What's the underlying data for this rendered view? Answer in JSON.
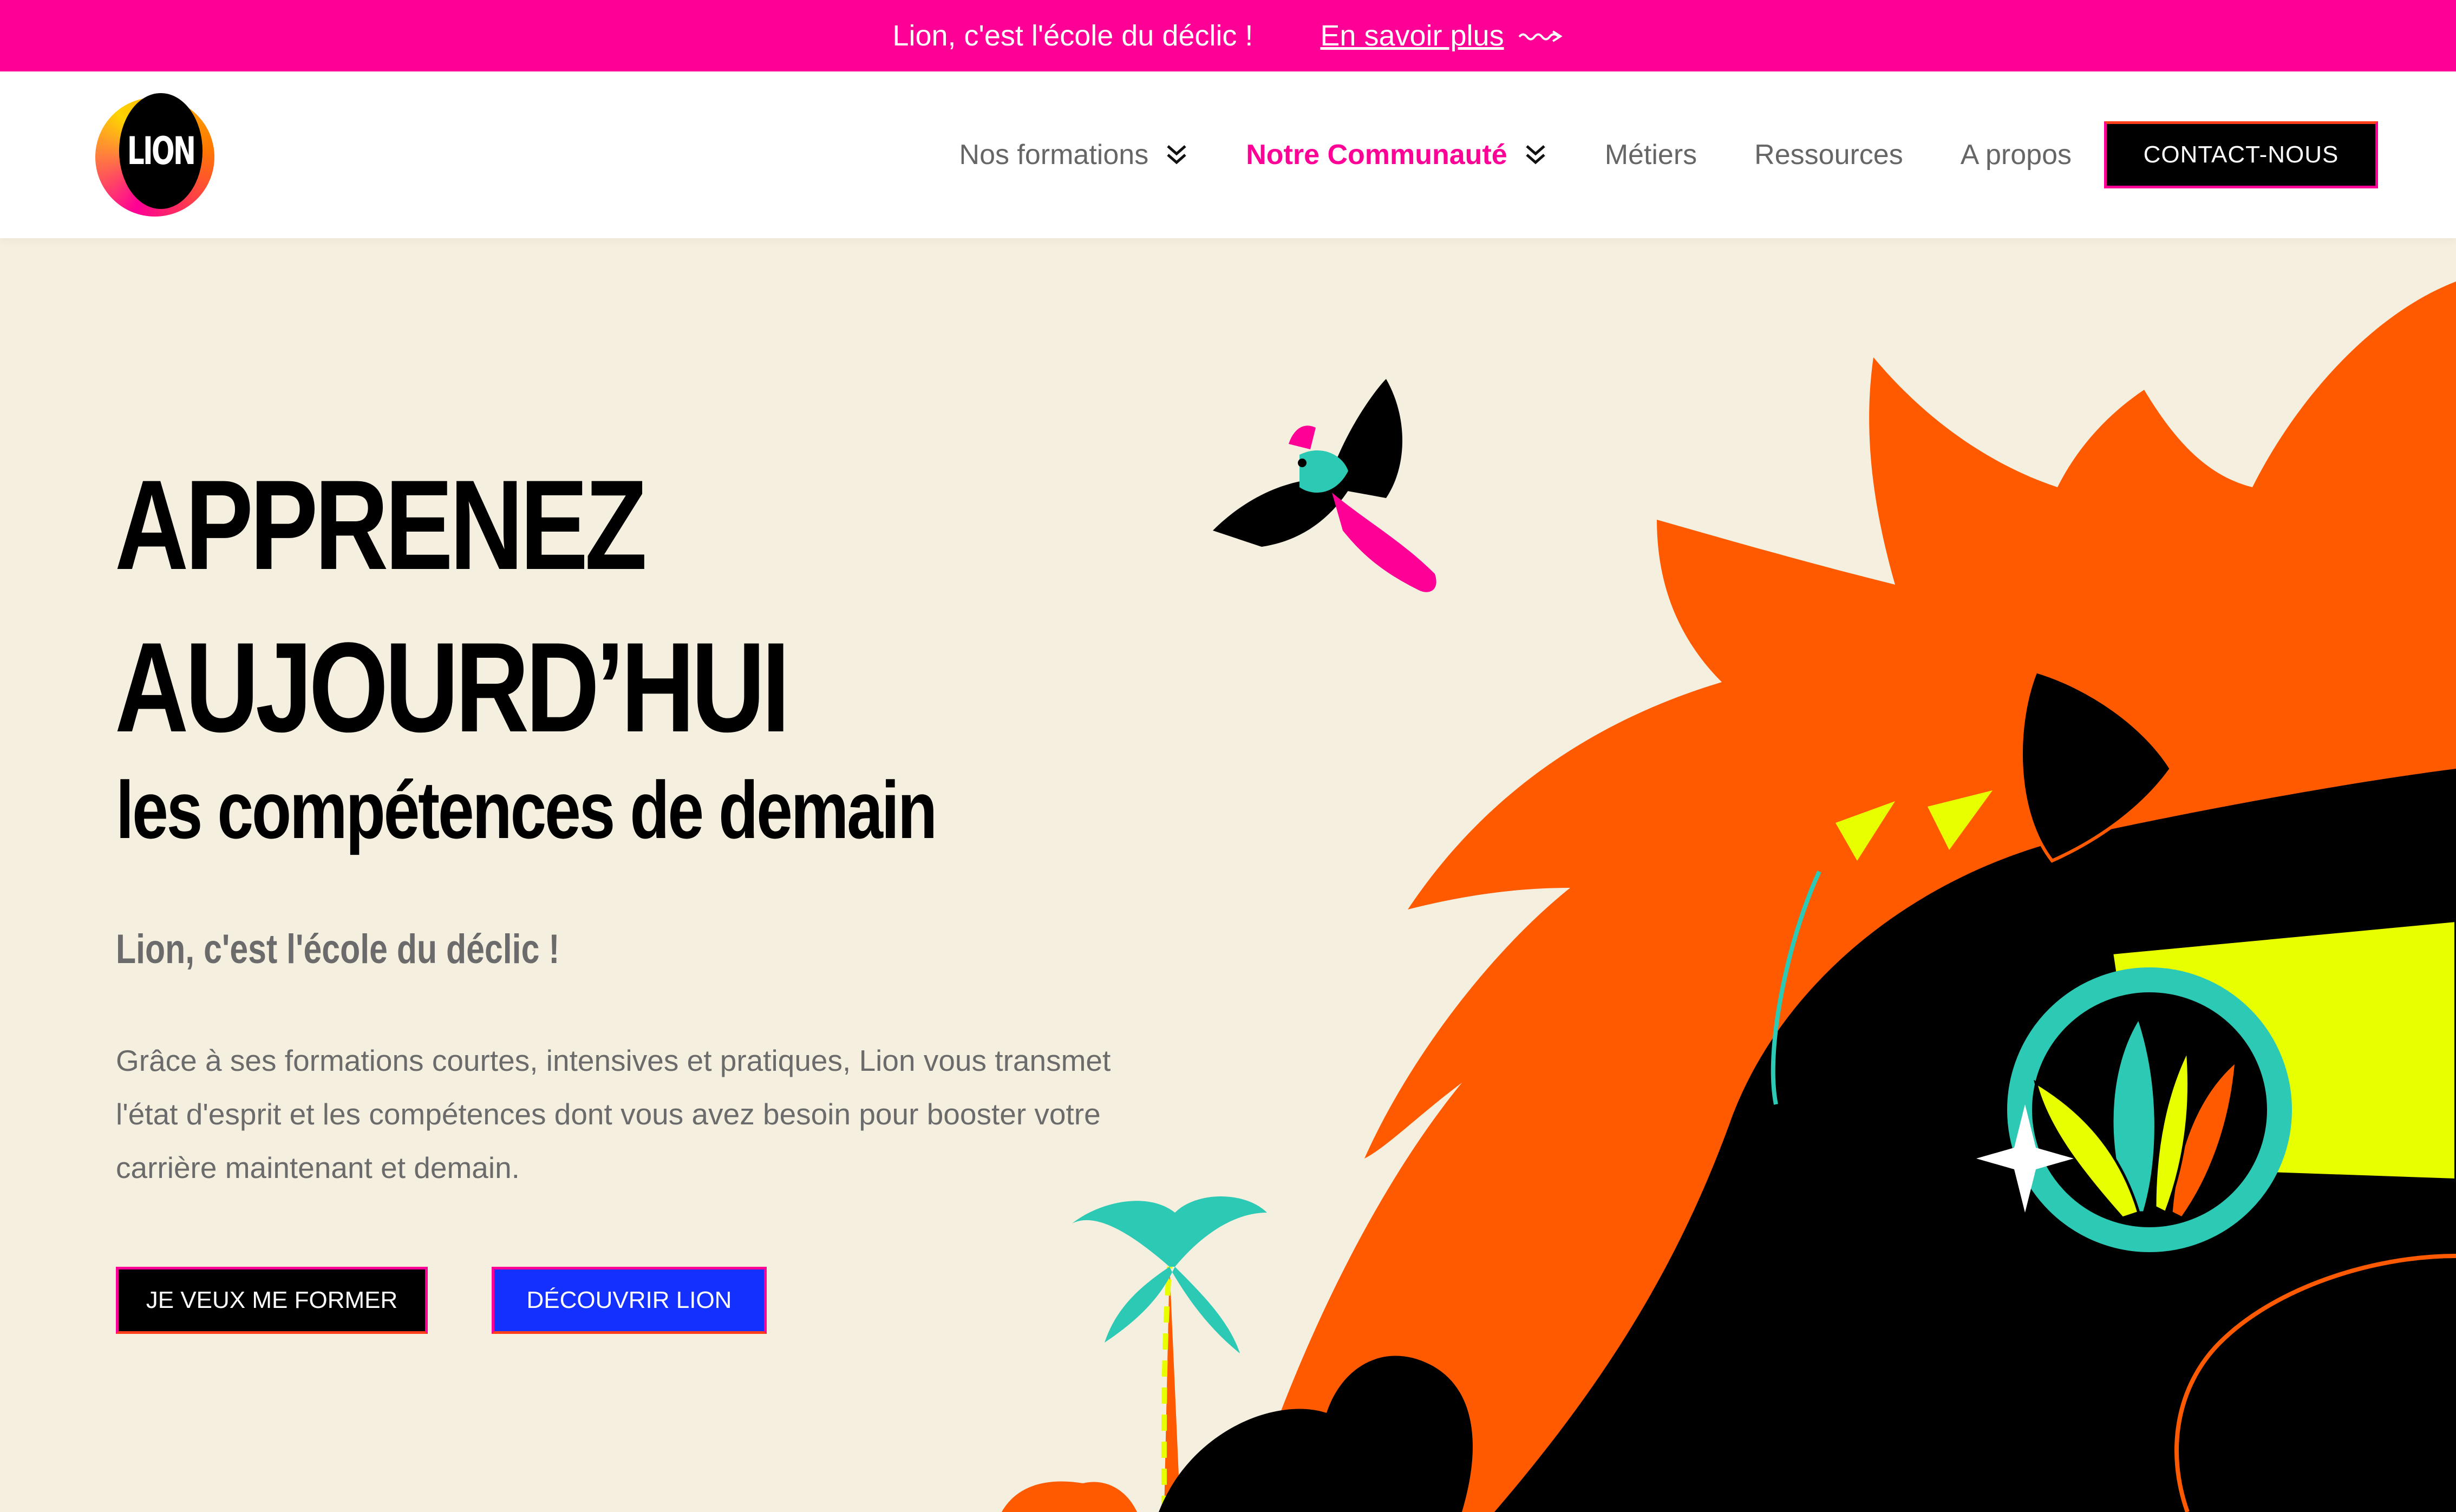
{
  "announcement": {
    "text": "Lion, c'est l'école du déclic !",
    "link_label": "En savoir plus"
  },
  "header": {
    "logo_text": "LION",
    "nav": [
      {
        "label": "Nos formations",
        "has_dropdown": true,
        "active": false
      },
      {
        "label": "Notre Communauté",
        "has_dropdown": true,
        "active": true
      },
      {
        "label": "Métiers",
        "has_dropdown": false,
        "active": false
      },
      {
        "label": "Ressources",
        "has_dropdown": false,
        "active": false
      },
      {
        "label": "A propos",
        "has_dropdown": false,
        "active": false
      }
    ],
    "cta_label": "CONTACT-NOUS"
  },
  "hero": {
    "title_line1": "APPRENEZ",
    "title_line2": "AUJOURD’HUI",
    "subtitle": "les compétences de demain",
    "tagline": "Lion, c'est l'école du déclic !",
    "body": "Grâce à ses formations courtes, intensives et pratiques, Lion vous transmet l'état d'esprit et les compétences dont vous avez besoin pour booster votre carrière maintenant et demain.",
    "primary_button": "JE VEUX ME FORMER",
    "secondary_button": "DÉCOUVRIR LION"
  },
  "colors": {
    "brand_pink": "#ff0096",
    "hero_bg": "#f5efdf",
    "lion_orange": "#ff5a00",
    "button_blue": "#1430ff",
    "accent_yellow": "#e8ff00",
    "accent_teal": "#2cc9b5"
  },
  "icons": {
    "promo_arrow": "squiggle-arrow-icon",
    "dropdown": "double-chevron-down-icon"
  }
}
